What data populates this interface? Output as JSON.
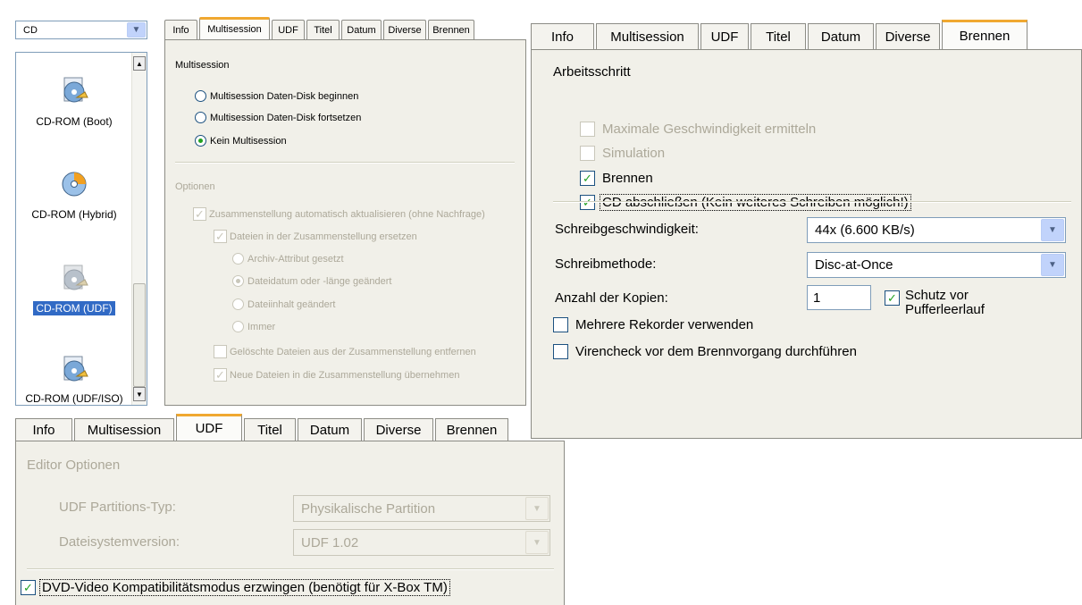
{
  "media": {
    "dropdown_value": "CD",
    "items": [
      {
        "label": "CD-ROM (Boot)",
        "icon": "cd-boot-icon"
      },
      {
        "label": "CD-ROM (Hybrid)",
        "icon": "cd-hybrid-icon"
      },
      {
        "label": "CD-ROM (UDF)",
        "icon": "cd-udf-icon",
        "selected": true
      },
      {
        "label": "CD-ROM (UDF/ISO)",
        "icon": "cd-udf-iso-icon"
      }
    ],
    "scroll_up": "▲",
    "scroll_down": "▼"
  },
  "ms_panel": {
    "tabs": [
      "Info",
      "Multisession",
      "UDF",
      "Titel",
      "Datum",
      "Diverse",
      "Brennen"
    ],
    "active_tab": "Multisession",
    "group_label": "Multisession",
    "radios": [
      {
        "label": "Multisession Daten-Disk beginnen",
        "checked": false
      },
      {
        "label": "Multisession Daten-Disk fortsetzen",
        "checked": false
      },
      {
        "label": "Kein Multisession",
        "checked": true
      }
    ],
    "options_label": "Optionen",
    "opt_update": "Zusammenstellung automatisch aktualisieren (ohne Nachfrage)",
    "opt_replace": "Dateien in der Zusammenstellung ersetzen",
    "sub_radios": [
      "Archiv-Attribut gesetzt",
      "Dateidatum oder -länge geändert",
      "Dateiinhalt geändert",
      "Immer"
    ],
    "opt_delete": "Gelöschte Dateien aus der Zusammenstellung entfernen",
    "opt_new": "Neue Dateien in die Zusammenstellung übernehmen"
  },
  "burn_panel": {
    "tabs": [
      "Info",
      "Multisession",
      "UDF",
      "Titel",
      "Datum",
      "Diverse",
      "Brennen"
    ],
    "active_tab": "Brennen",
    "step_label": "Arbeitsschritt",
    "chk_max_speed": "Maximale Geschwindigkeit ermitteln",
    "chk_simulation": "Simulation",
    "chk_burn": "Brennen",
    "chk_finalize": "CD abschließen (Kein weiteres Schreiben möglich!)",
    "speed_label": "Schreibgeschwindigkeit:",
    "speed_value": "44x (6.600 KB/s)",
    "method_label": "Schreibmethode:",
    "method_value": "Disc-at-Once",
    "copies_label": "Anzahl der Kopien:",
    "copies_value": "1",
    "chk_protect_1": "Schutz vor",
    "chk_protect_2": "Pufferleerlauf",
    "chk_multi_rec": "Mehrere Rekorder verwenden",
    "chk_virus": "Virencheck vor dem Brennvorgang durchführen"
  },
  "udf_panel": {
    "tabs": [
      "Info",
      "Multisession",
      "UDF",
      "Titel",
      "Datum",
      "Diverse",
      "Brennen"
    ],
    "active_tab": "UDF",
    "editor_label": "Editor Optionen",
    "partition_label": "UDF Partitions-Typ:",
    "partition_value": "Physikalische Partition",
    "fs_label": "Dateisystemversion:",
    "fs_value": "UDF 1.02",
    "chk_dvd": "DVD-Video Kompatibilitätsmodus erzwingen (benötigt für X-Box TM)"
  },
  "colors": {
    "check": "#21a121",
    "tab_accent": "#f0a830",
    "panel_bg": "#f1f0e9",
    "disabled_text": "#aca899",
    "selection": "#316ac5"
  }
}
